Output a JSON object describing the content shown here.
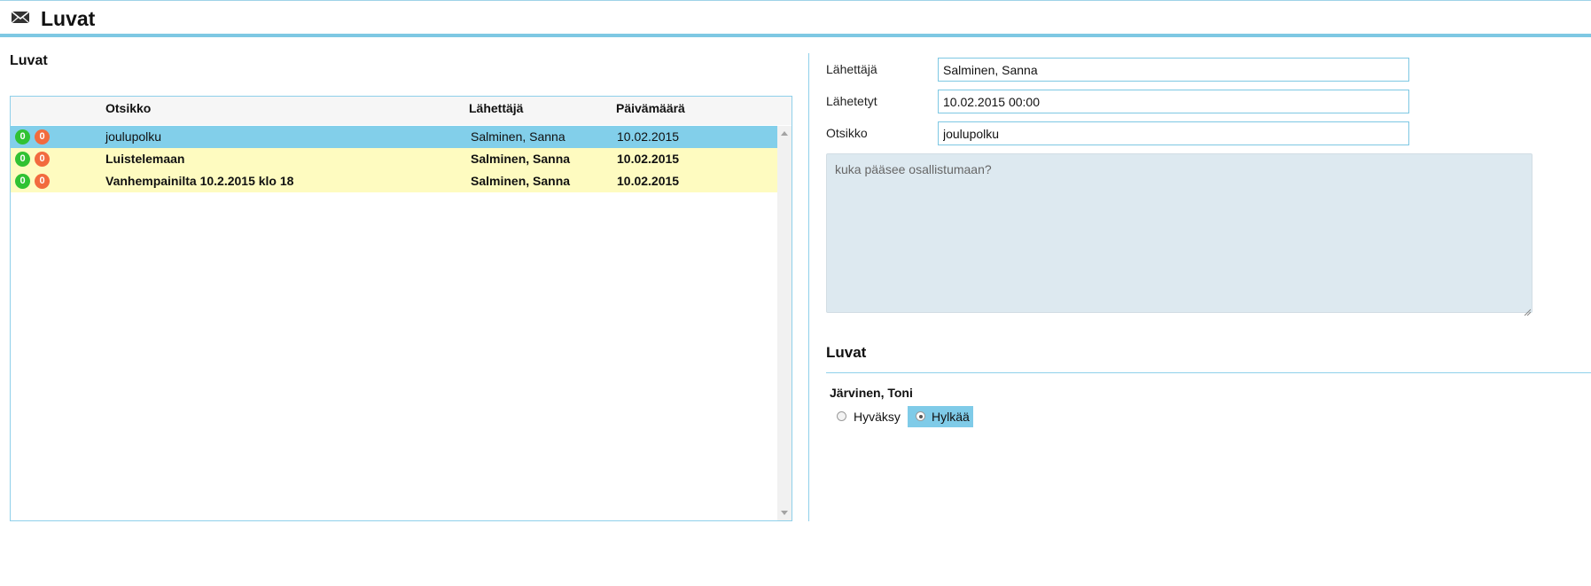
{
  "header": {
    "title": "Luvat",
    "icon": "envelope-icon"
  },
  "list": {
    "title": "Luvat",
    "columns": {
      "subject": "Otsikko",
      "sender": "Lähettäjä",
      "date": "Päivämäärä"
    },
    "rows": [
      {
        "green_count": "0",
        "red_count": "0",
        "subject": "joulupolku",
        "sender": "Salminen, Sanna",
        "date": "10.02.2015",
        "state": "selected"
      },
      {
        "green_count": "0",
        "red_count": "0",
        "subject": "Luistelemaan",
        "sender": "Salminen, Sanna",
        "date": "10.02.2015",
        "state": "unread"
      },
      {
        "green_count": "0",
        "red_count": "0",
        "subject": "Vanhempainilta 10.2.2015 klo 18",
        "sender": "Salminen, Sanna",
        "date": "10.02.2015",
        "state": "unread"
      }
    ]
  },
  "detail": {
    "sender_label": "Lähettäjä",
    "sender_value": "Salminen, Sanna",
    "sent_label": "Lähetetyt",
    "sent_value": "10.02.2015 00:00",
    "subject_label": "Otsikko",
    "subject_value": "joulupolku",
    "message": "kuka pääsee osallistumaan?"
  },
  "permissions": {
    "title": "Luvat",
    "person": "Järvinen, Toni",
    "approve_label": "Hyväksy",
    "reject_label": "Hylkää",
    "selected": "reject"
  },
  "colors": {
    "accent": "#7ec8e3",
    "selected_row": "#82cfea",
    "unread_row": "#fefbc0",
    "badge_green": "#30c233",
    "badge_red": "#f26b3e"
  }
}
